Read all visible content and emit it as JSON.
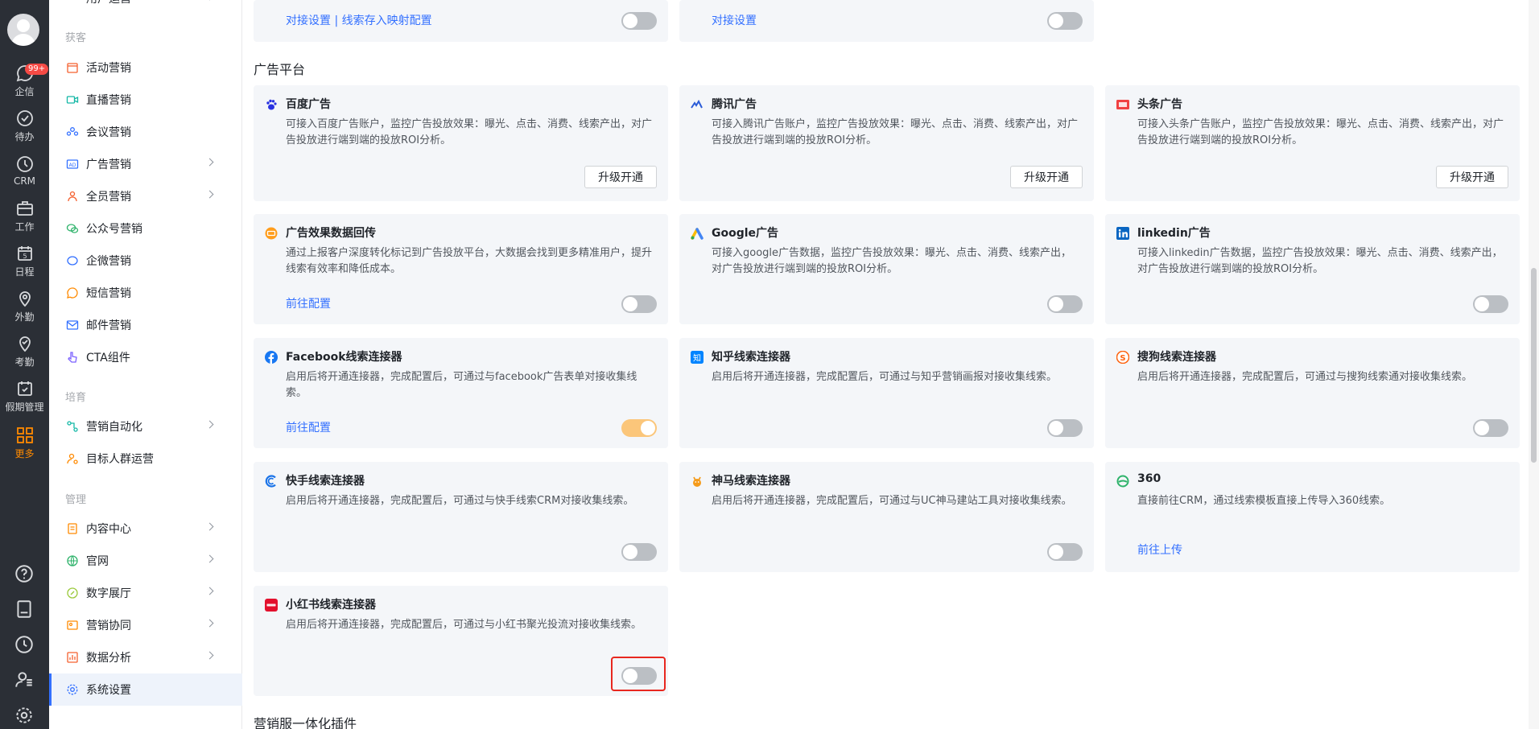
{
  "rail": {
    "badge": "99+",
    "items": [
      {
        "label": "企信",
        "icon": "chat-icon"
      },
      {
        "label": "待办",
        "icon": "check-circle-icon"
      },
      {
        "label": "CRM",
        "icon": "clock-icon"
      },
      {
        "label": "工作",
        "icon": "briefcase-icon"
      },
      {
        "label": "日程",
        "icon": "calendar-icon",
        "day": "5"
      },
      {
        "label": "外勤",
        "icon": "location-icon"
      },
      {
        "label": "考勤",
        "icon": "pin-check-icon"
      },
      {
        "label": "假期管理",
        "icon": "calendar-check-icon"
      },
      {
        "label": "更多",
        "icon": "grid-icon"
      }
    ]
  },
  "menu": {
    "top_item": "用户运营",
    "groups": [
      {
        "title": "获客"
      },
      {
        "title": "培育"
      },
      {
        "title": "管理"
      }
    ],
    "items": [
      {
        "label": "活动营销"
      },
      {
        "label": "直播营销"
      },
      {
        "label": "会议营销"
      },
      {
        "label": "广告营销"
      },
      {
        "label": "全员营销"
      },
      {
        "label": "公众号营销"
      },
      {
        "label": "企微营销"
      },
      {
        "label": "短信营销"
      },
      {
        "label": "邮件营销"
      },
      {
        "label": "CTA组件"
      },
      {
        "label": "营销自动化"
      },
      {
        "label": "目标人群运营"
      },
      {
        "label": "内容中心"
      },
      {
        "label": "官网"
      },
      {
        "label": "数字展厅"
      },
      {
        "label": "营销协同"
      },
      {
        "label": "数据分析"
      },
      {
        "label": "系统设置"
      }
    ]
  },
  "top_cards": [
    {
      "link": "对接设置 | 线索存入映射配置"
    },
    {
      "link": "对接设置"
    }
  ],
  "sections": {
    "ad_platform": "广告平台",
    "marketing_plugin": "营销服一体化插件"
  },
  "upgrade_label": "升级开通",
  "cards": [
    {
      "title": "百度广告",
      "desc": "可接入百度广告账户，监控广告投放效果：曝光、点击、消费、线索产出，对广告投放进行端到端的投放ROI分析。"
    },
    {
      "title": "腾讯广告",
      "desc": "可接入腾讯广告账户，监控广告投放效果：曝光、点击、消费、线索产出，对广告投放进行端到端的投放ROI分析。"
    },
    {
      "title": "头条广告",
      "desc": "可接入头条广告账户，监控广告投放效果：曝光、点击、消费、线索产出，对广告投放进行端到端的投放ROI分析。"
    },
    {
      "title": "广告效果数据回传",
      "desc": "通过上报客户深度转化标记到广告投放平台，大数据会找到更多精准用户，提升线索有效率和降低成本。",
      "link": "前往配置"
    },
    {
      "title": "Google广告",
      "desc": "可接入google广告数据，监控广告投放效果：曝光、点击、消费、线索产出，对广告投放进行端到端的投放ROI分析。"
    },
    {
      "title": "linkedin广告",
      "desc": "可接入linkedin广告数据，监控广告投放效果：曝光、点击、消费、线索产出，对广告投放进行端到端的投放ROI分析。"
    },
    {
      "title": "Facebook线索连接器",
      "desc": "启用后将开通连接器，完成配置后，可通过与facebook广告表单对接收集线索。",
      "link": "前往配置"
    },
    {
      "title": "知乎线索连接器",
      "desc": "启用后将开通连接器，完成配置后，可通过与知乎营销画报对接收集线索。"
    },
    {
      "title": "搜狗线索连接器",
      "desc": "启用后将开通连接器，完成配置后，可通过与搜狗线索通对接收集线索。"
    },
    {
      "title": "快手线索连接器",
      "desc": "启用后将开通连接器，完成配置后，可通过与快手线索CRM对接收集线索。"
    },
    {
      "title": "神马线索连接器",
      "desc": "启用后将开通连接器，完成配置后，可通过与UC神马建站工具对接收集线索。"
    },
    {
      "title": "360",
      "desc": "直接前往CRM，通过线索模板直接上传导入360线索。",
      "link": "前往上传"
    },
    {
      "title": "小红书线索连接器",
      "desc": "启用后将开通连接器，完成配置后，可通过与小红书聚光投流对接收集线索。"
    }
  ],
  "toggles": {
    "facebook": "on",
    "others": "off"
  },
  "colors": {
    "rail_bg": "#2b2f36",
    "accent": "#3370ff",
    "active_orange": "#ff8a00",
    "card_bg": "#f4f6f9",
    "toggle_on": "#fbc67a",
    "highlight_red": "#e8271f"
  }
}
